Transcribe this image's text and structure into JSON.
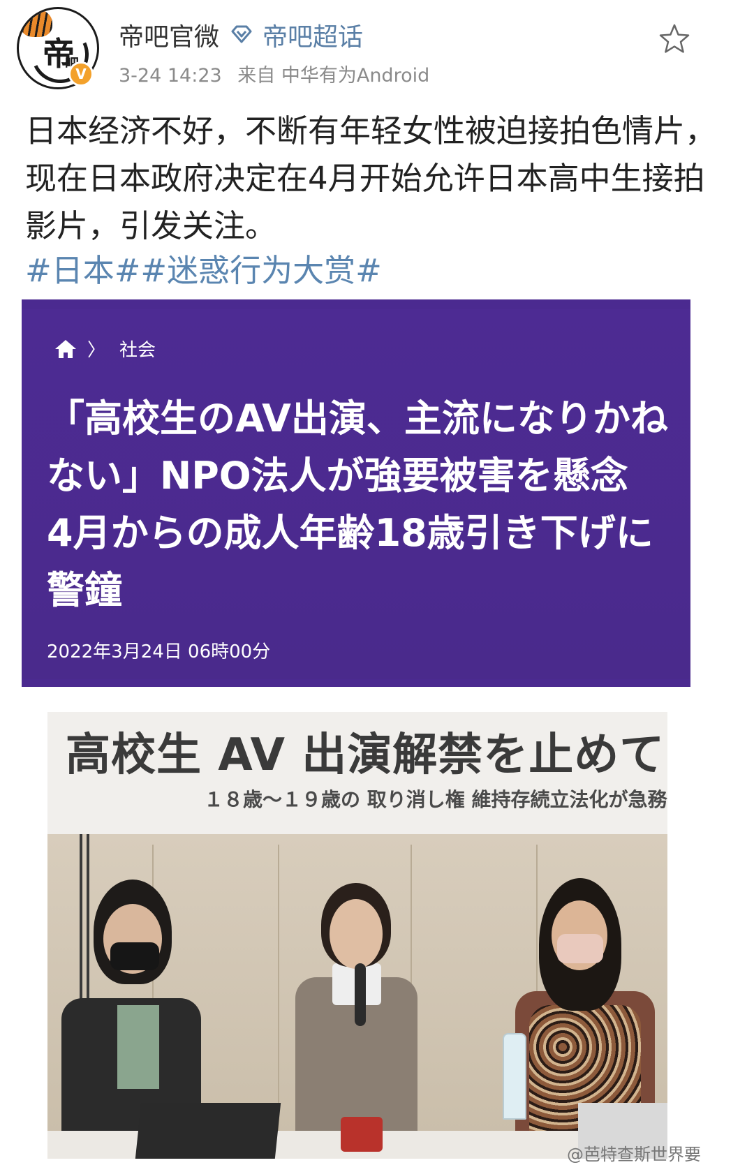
{
  "header": {
    "account_name": "帝吧官微",
    "super_topic": "帝吧超话",
    "time": "3-24 14:23",
    "source": "来自 中华有为Android",
    "avatar_text": "帝",
    "avatar_text_small": "吧",
    "verified_badge": "V"
  },
  "post": {
    "text": "日本经济不好，不断有年轻女性被迫接拍色情片，现在日本政府决定在4月开始允许日本高中生接拍影片，引发关注。",
    "hashtags": [
      "#日本#",
      "#迷惑行为大赏#"
    ]
  },
  "news_card": {
    "breadcrumb_sep": "〉",
    "category": "社会",
    "headline": "「高校生のAV出演、主流になりかねない」NPO法人が強要被害を懸念　4月からの成人年齢18歳引き下げに警鐘",
    "date": "2022年3月24日 06時00分",
    "background_color": "#4b2a90"
  },
  "photo": {
    "banner_title": "高校生 AV 出演解禁を止めてく",
    "banner_subtitle": "１８歳～１９歳の 取り消し権 維持存続立法化が急務"
  },
  "watermark": "@芭特查斯世界要"
}
